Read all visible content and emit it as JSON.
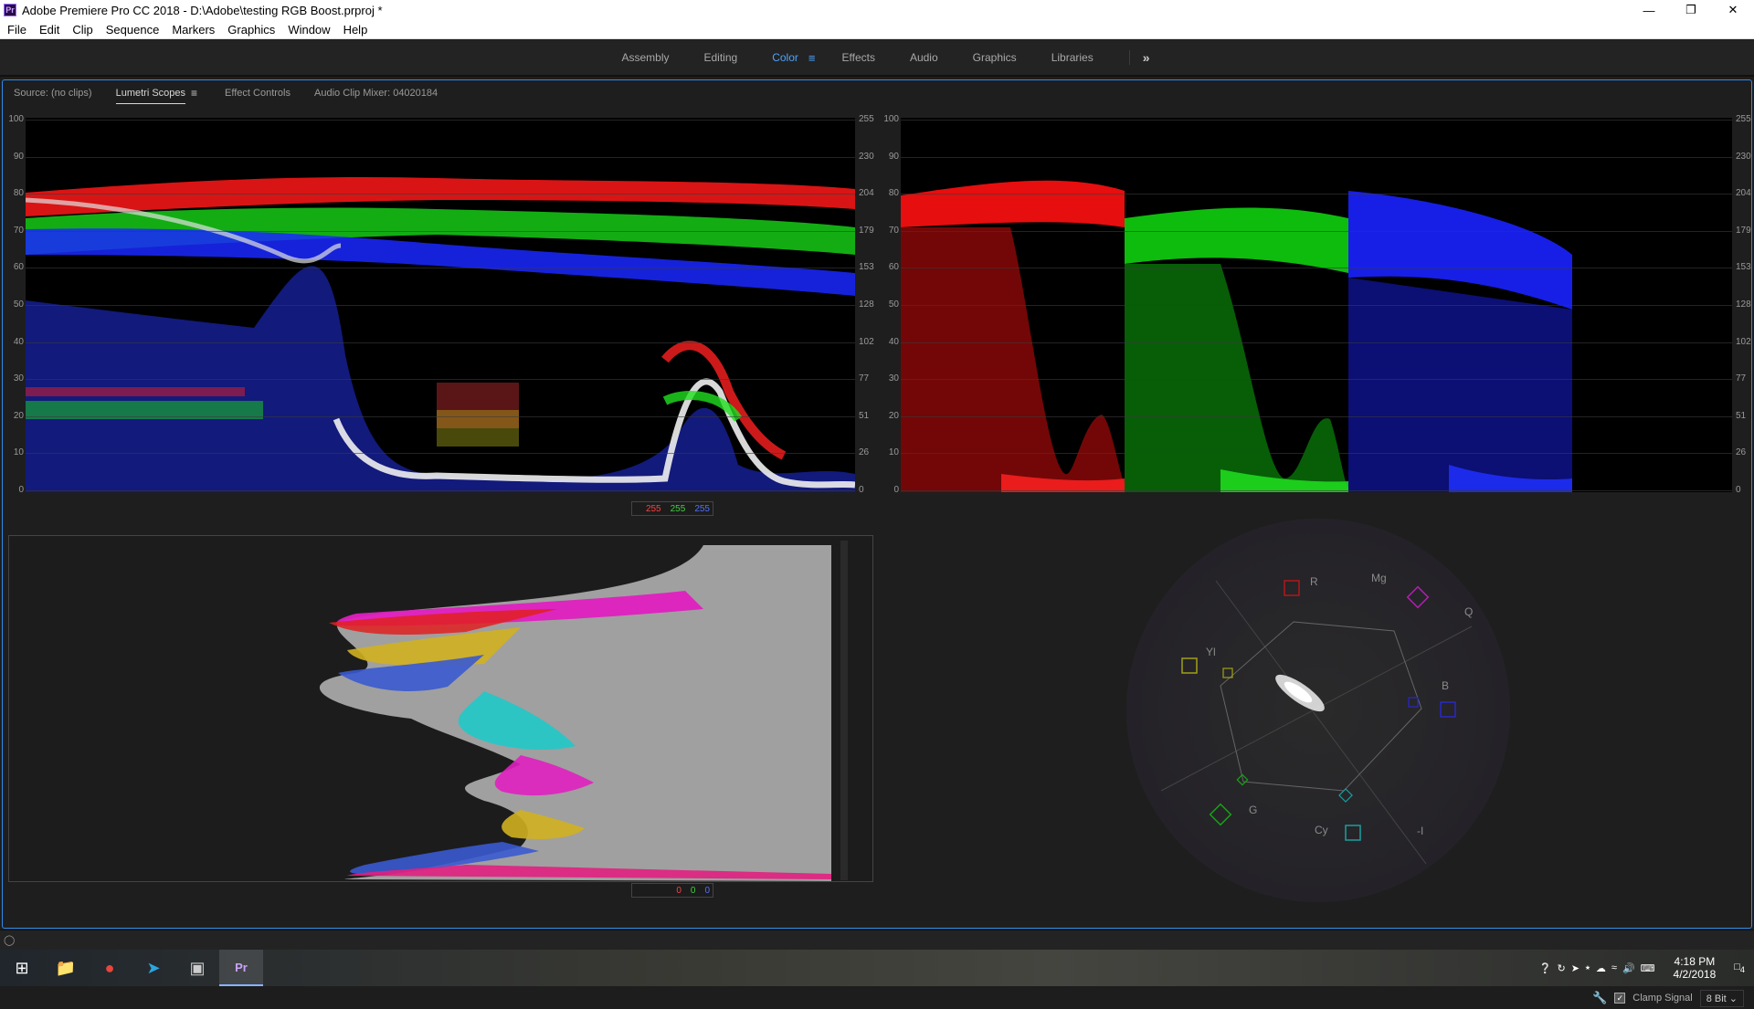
{
  "window": {
    "title": "Adobe Premiere Pro CC 2018 - D:\\Adobe\\testing RGB Boost.prproj *",
    "app_badge": "Pr"
  },
  "menu": [
    "File",
    "Edit",
    "Clip",
    "Sequence",
    "Markers",
    "Graphics",
    "Window",
    "Help"
  ],
  "workspaces": {
    "tabs": [
      "Assembly",
      "Editing",
      "Color",
      "Effects",
      "Audio",
      "Graphics",
      "Libraries"
    ],
    "active": "Color",
    "menu_glyph": "≡",
    "overflow_glyph": "»"
  },
  "panel": {
    "tabs": [
      "Source: (no clips)",
      "Lumetri Scopes",
      "Effect Controls",
      "Audio Clip Mixer: 04020184"
    ],
    "active": "Lumetri Scopes",
    "menu_glyph": "≡"
  },
  "waveform": {
    "left_labels": [
      "100",
      "90",
      "80",
      "70",
      "60",
      "50",
      "40",
      "30",
      "20",
      "10",
      "0"
    ],
    "right_labels": [
      "255",
      "230",
      "204",
      "179",
      "153",
      "128",
      "102",
      "77",
      "51",
      "26",
      "0"
    ]
  },
  "histogram": {
    "top": {
      "r": "255",
      "g": "255",
      "b": "255"
    },
    "bottom": {
      "r": "0",
      "g": "0",
      "b": "0"
    }
  },
  "vectorscope": {
    "labels": [
      "R",
      "Mg",
      "Q",
      "B",
      "-I",
      "Cy",
      "G",
      "Yl"
    ]
  },
  "bottombar": {
    "clamp_label": "Clamp Signal",
    "clamp_checked": true,
    "bit_depth": "8 Bit"
  },
  "taskbar": {
    "time": "4:18 PM",
    "date": "4/2/2018",
    "notif_count": "4"
  },
  "colors": {
    "accent": "#2d8ceb",
    "active_tab": "#4aa3ff",
    "red": "#ff2020",
    "green": "#20e020",
    "blue": "#2030ff"
  }
}
